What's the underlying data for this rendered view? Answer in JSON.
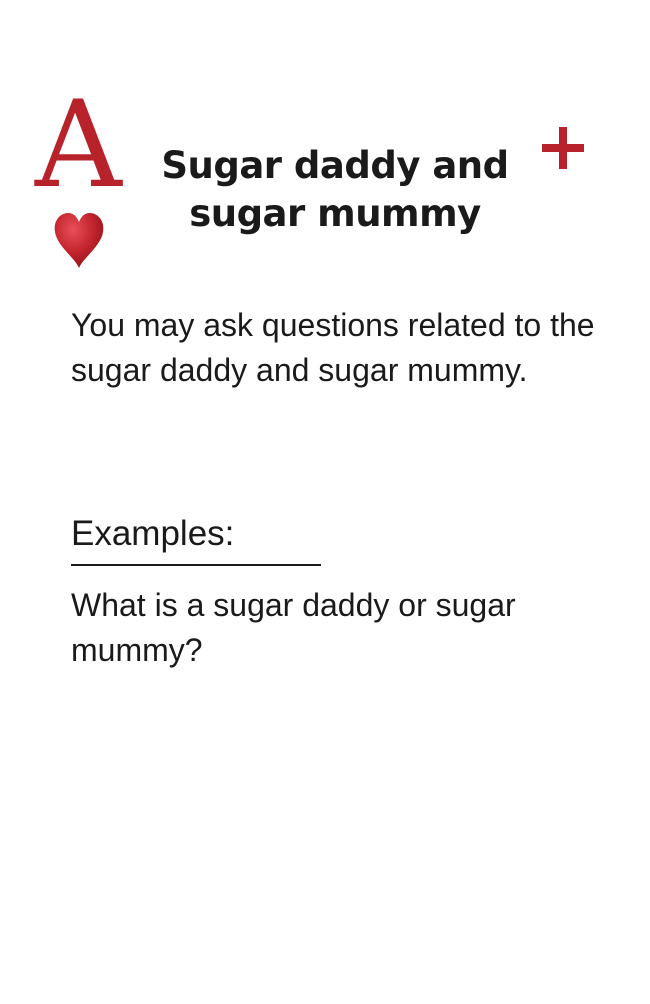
{
  "card": {
    "corner_letter": "A",
    "suit_icon": "heart-icon",
    "badge_icon": "plus-icon",
    "accent_color": "#b8222a",
    "title_line1": "Sugar daddy and",
    "title_line2": "sugar mummy",
    "body": "You may ask questions related to the sugar daddy and sugar mummy.",
    "examples_heading": "Examples:",
    "example_1": "What is a sugar daddy or sugar mummy?"
  }
}
